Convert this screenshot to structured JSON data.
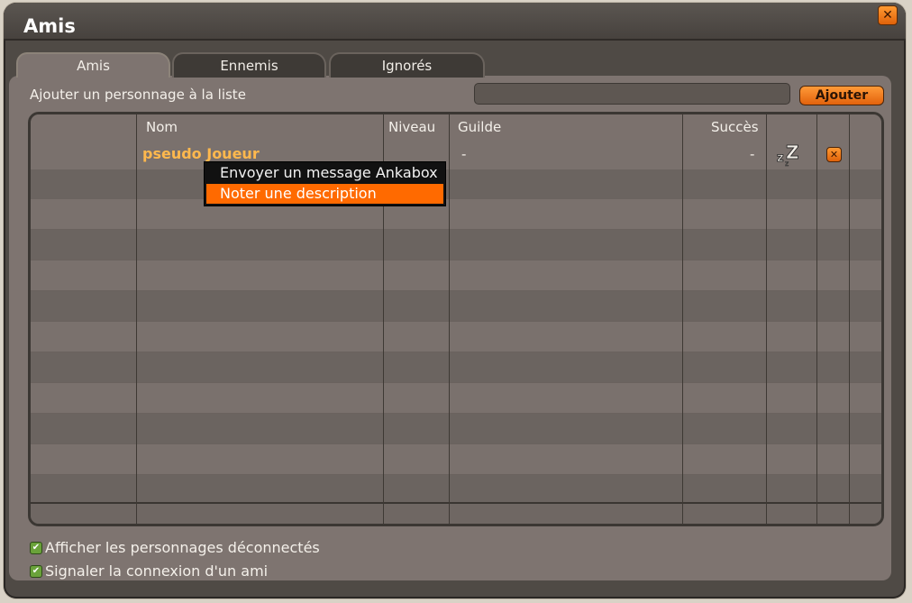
{
  "window": {
    "title": "Amis",
    "close_icon": "close-icon"
  },
  "tabs": [
    {
      "label": "Amis",
      "active": true
    },
    {
      "label": "Ennemis",
      "active": false
    },
    {
      "label": "Ignorés",
      "active": false
    }
  ],
  "add_row": {
    "label": "Ajouter un personnage à la liste",
    "input_value": "",
    "button_label": "Ajouter"
  },
  "table": {
    "headers": {
      "nom": "Nom",
      "niveau": "Niveau",
      "guilde": "Guilde",
      "succes": "Succès"
    },
    "rows": [
      {
        "nom": "pseudo Joueur",
        "niveau": "",
        "guilde": "-",
        "succes": "-",
        "status_icon": "sleep-zz-icon",
        "remove_icon": "remove-icon"
      }
    ]
  },
  "context_menu": {
    "items": [
      {
        "label": "Envoyer un message Ankabox",
        "highlighted": false
      },
      {
        "label": "Noter une description",
        "highlighted": true
      }
    ]
  },
  "options": [
    {
      "label": "Afficher les personnages déconnectés",
      "checked": true
    },
    {
      "label": "Signaler la connexion d'un ami",
      "checked": true
    }
  ],
  "colors": {
    "accent": "#ff6a00",
    "name_color": "#ffb84d",
    "panel": "#7e7470"
  }
}
